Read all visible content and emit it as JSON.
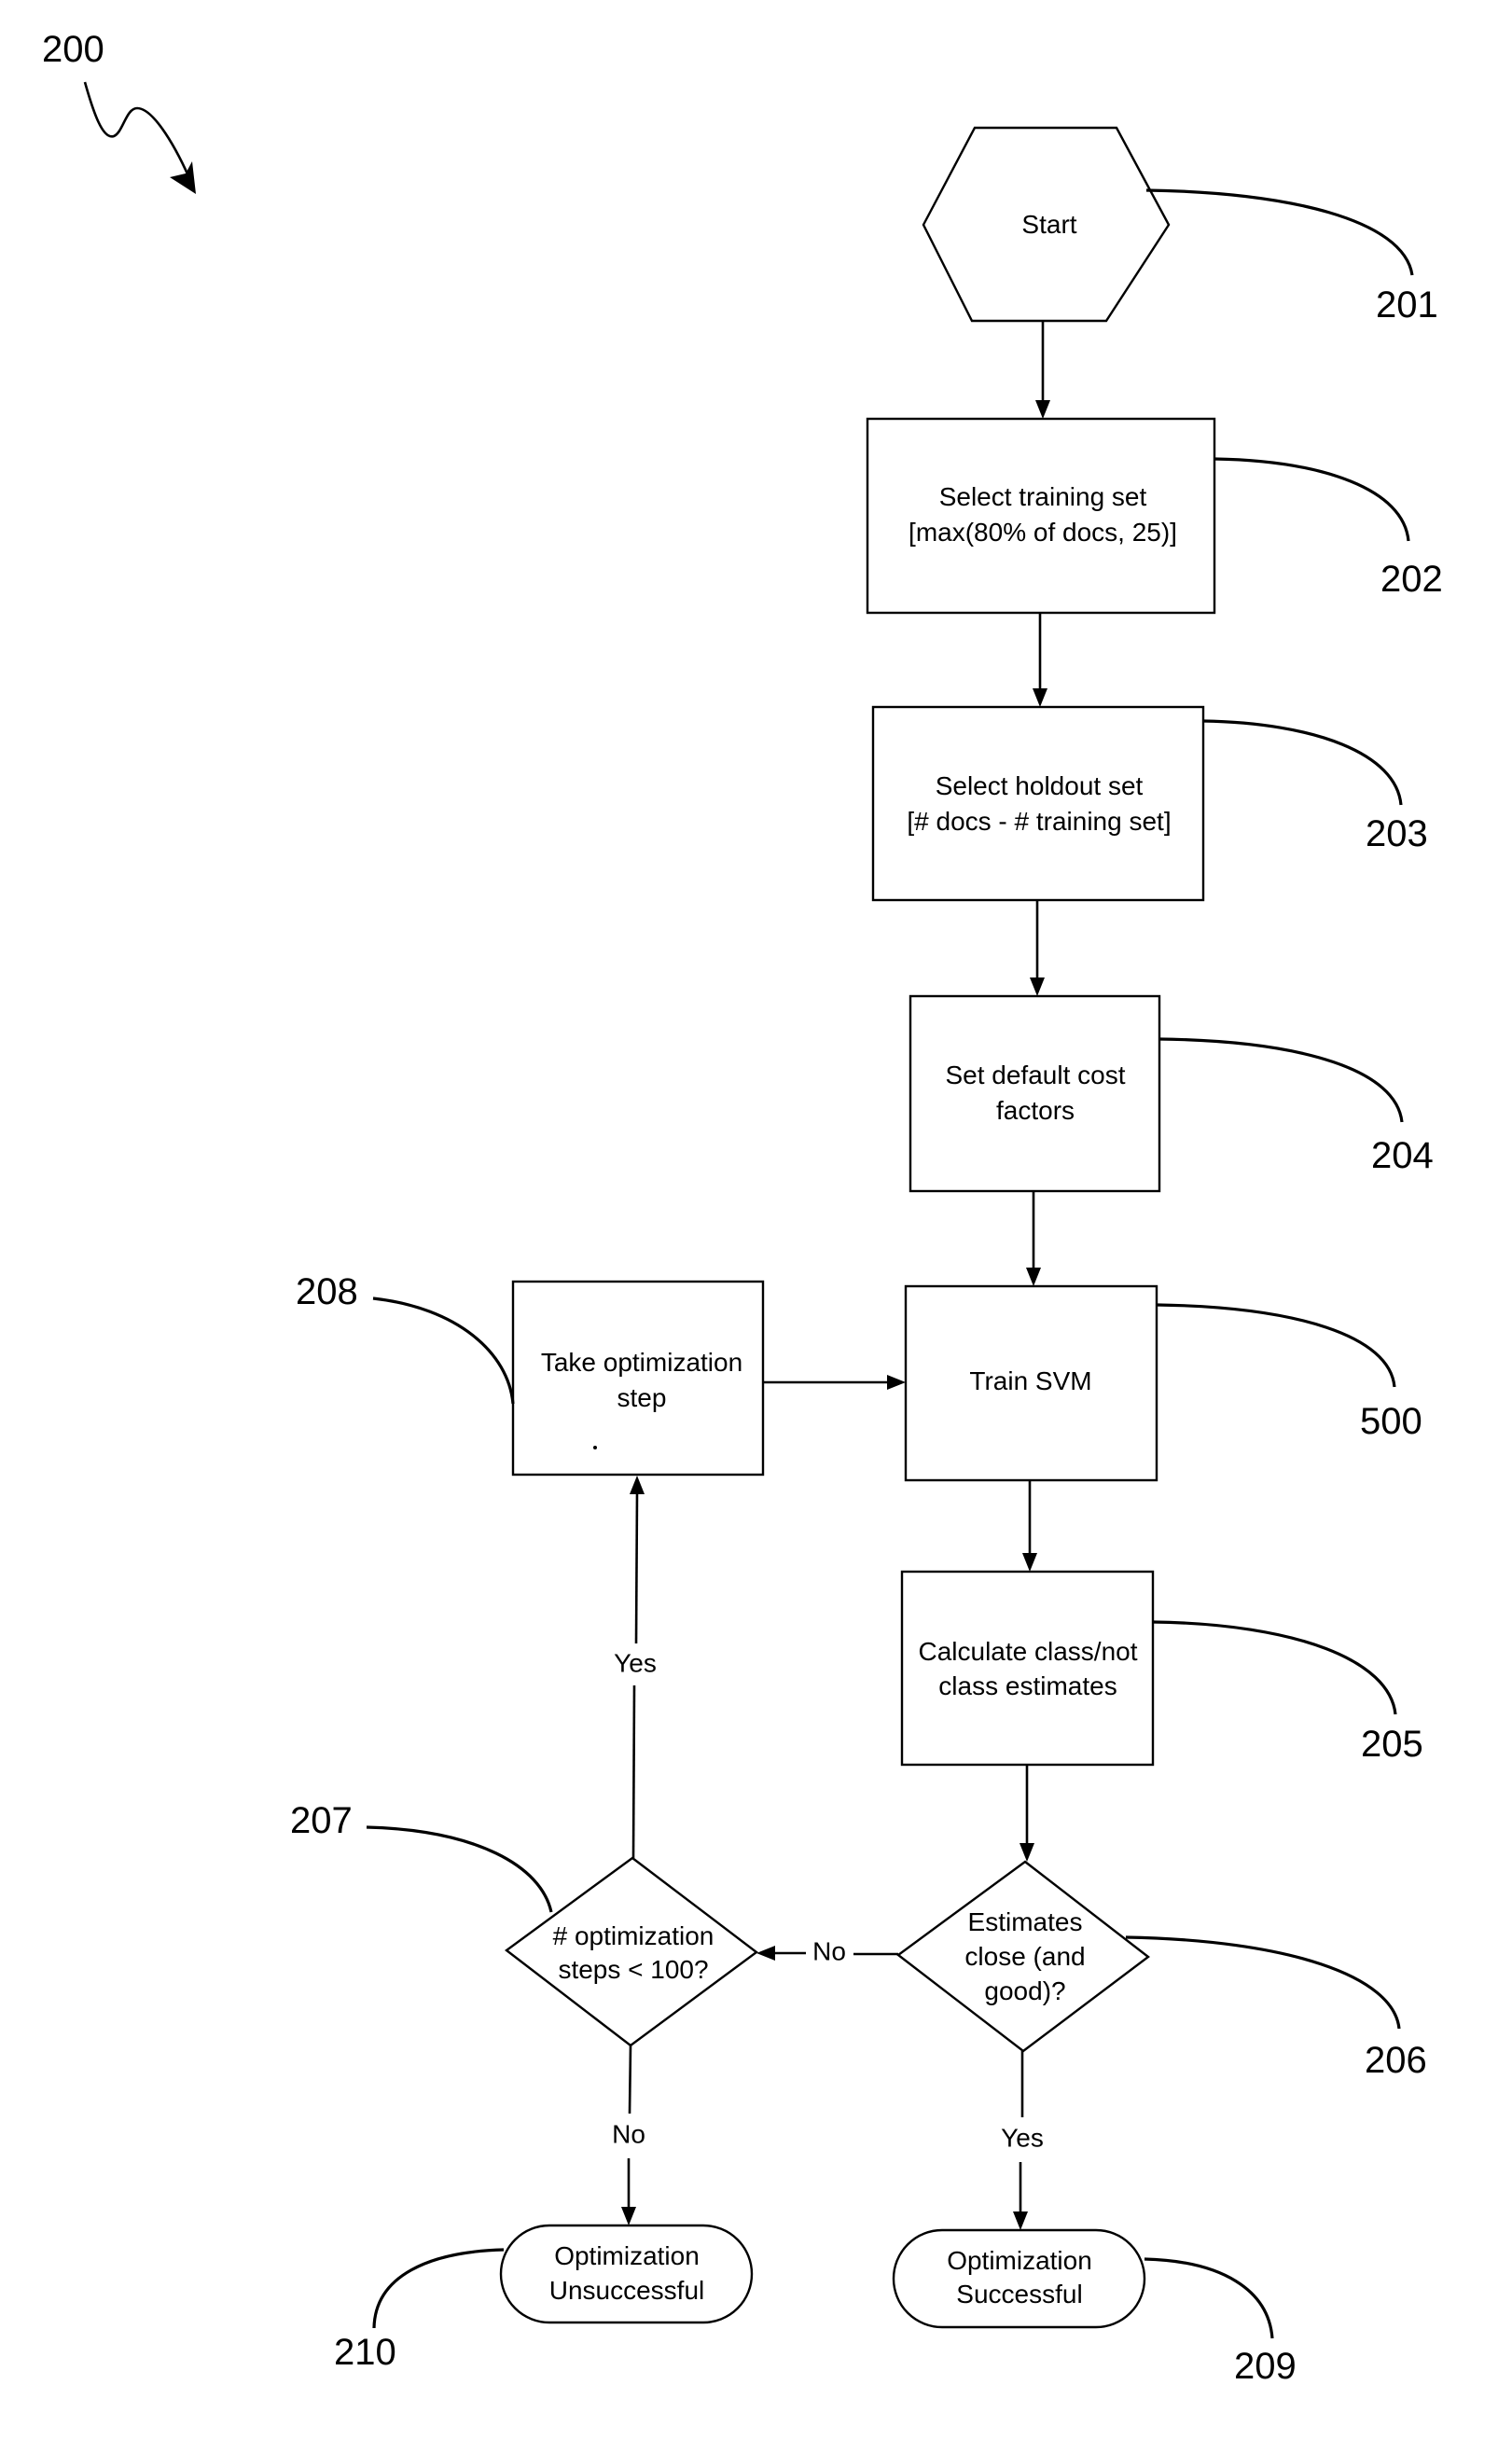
{
  "figure": {
    "reference": "200"
  },
  "nodes": {
    "start": {
      "ref": "201",
      "shape": "hexagon",
      "lines": [
        "Start"
      ]
    },
    "select_training": {
      "ref": "202",
      "shape": "process",
      "lines": [
        "Select training set",
        "[max(80% of docs, 25)]"
      ]
    },
    "select_holdout": {
      "ref": "203",
      "shape": "process",
      "lines": [
        "Select holdout set",
        "[# docs - # training set]"
      ]
    },
    "set_cost": {
      "ref": "204",
      "shape": "process",
      "lines": [
        "Set default cost",
        "factors"
      ]
    },
    "train_svm": {
      "ref": "500",
      "shape": "process",
      "lines": [
        "Train SVM"
      ]
    },
    "calc_estimates": {
      "ref": "205",
      "shape": "process",
      "lines": [
        "Calculate class/not",
        "class estimates"
      ]
    },
    "estimates_close": {
      "ref": "206",
      "shape": "decision",
      "lines": [
        "Estimates",
        "close (and",
        "good)?"
      ]
    },
    "opt_steps": {
      "ref": "207",
      "shape": "decision",
      "lines": [
        "# optimization",
        "steps < 100?"
      ]
    },
    "take_step": {
      "ref": "208",
      "shape": "process",
      "lines": [
        "Take optimization",
        "step"
      ]
    },
    "success": {
      "ref": "209",
      "shape": "terminal",
      "lines": [
        "Optimization",
        "Successful"
      ]
    },
    "failure": {
      "ref": "210",
      "shape": "terminal",
      "lines": [
        "Optimization",
        "Unsuccessful"
      ]
    }
  },
  "edges": [
    {
      "from": "201",
      "to": "202",
      "label": ""
    },
    {
      "from": "202",
      "to": "203",
      "label": ""
    },
    {
      "from": "203",
      "to": "204",
      "label": ""
    },
    {
      "from": "204",
      "to": "500",
      "label": ""
    },
    {
      "from": "500",
      "to": "205",
      "label": ""
    },
    {
      "from": "205",
      "to": "206",
      "label": ""
    },
    {
      "from": "206",
      "to": "209",
      "label": "Yes"
    },
    {
      "from": "206",
      "to": "207",
      "label": "No"
    },
    {
      "from": "207",
      "to": "208",
      "label": "Yes"
    },
    {
      "from": "207",
      "to": "210",
      "label": "No"
    },
    {
      "from": "208",
      "to": "500",
      "label": ""
    }
  ],
  "branch_labels": {
    "e206_yes": "Yes",
    "e206_no": "No",
    "e207_yes": "Yes",
    "e207_no": "No"
  }
}
